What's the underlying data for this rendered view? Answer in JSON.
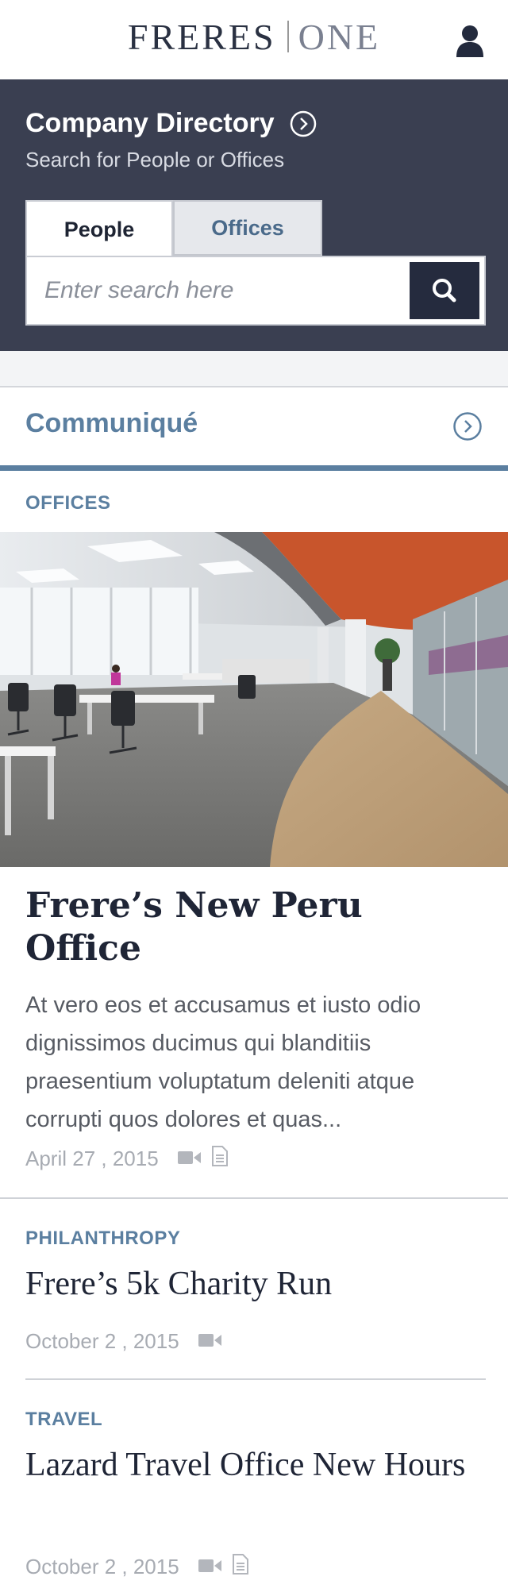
{
  "header": {
    "brand_left": "FRERES",
    "brand_right": "ONE",
    "user_icon": "user-icon"
  },
  "directory": {
    "title": "Company Directory",
    "subtitle": "Search for People or Offices",
    "tabs": [
      {
        "label": "People",
        "selected": true
      },
      {
        "label": "Offices",
        "selected": false
      }
    ],
    "search": {
      "placeholder": "Enter search here",
      "value": ""
    },
    "background": "#3a3f51"
  },
  "communique": {
    "label": "Communiqué"
  },
  "articles": [
    {
      "category": "OFFICES",
      "title": "Frere’s New Peru Office",
      "excerpt": "At vero eos et accusamus et iusto odio dignissimos ducimus qui blanditiis praesentium voluptatum deleniti atque corrupti quos dolores et quas...",
      "date": "April 27 , 2015",
      "icons": [
        "video-icon",
        "document-icon"
      ]
    },
    {
      "category": "PHILANTHROPY",
      "title": "Frere’s 5k Charity Run",
      "date": "October 2 , 2015",
      "icons": [
        "video-icon"
      ]
    },
    {
      "category": "TRAVEL",
      "title": "Lazard Travel Office New Hours",
      "date": "October 2 , 2015",
      "icons": [
        "video-icon",
        "document-icon"
      ]
    }
  ],
  "colors": {
    "accent": "#5b7fa0",
    "navy": "#252b3e",
    "meta": "#a7abb2"
  }
}
